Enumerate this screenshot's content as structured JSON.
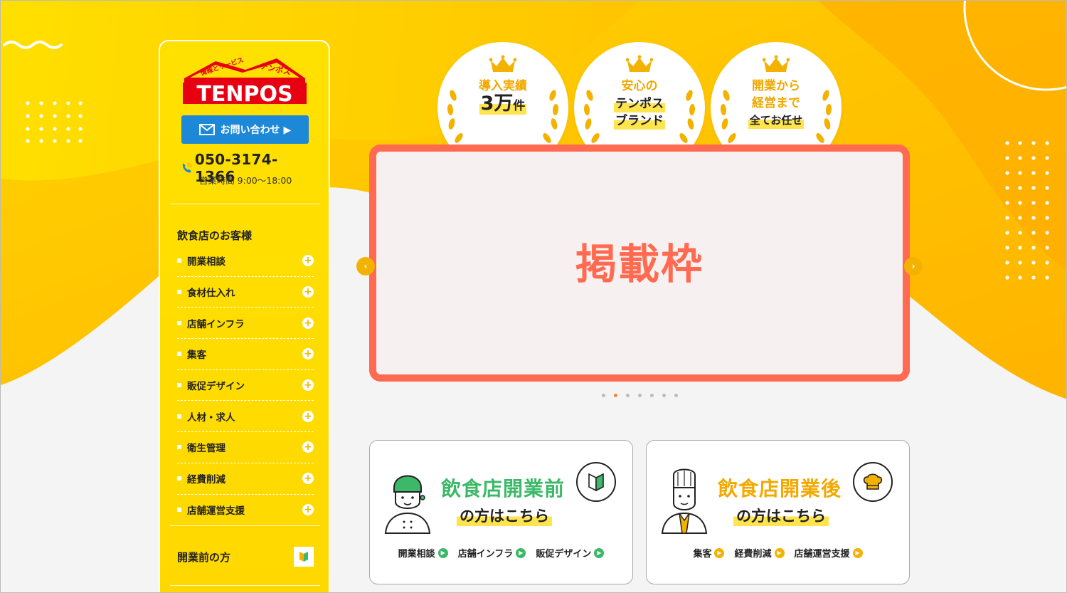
{
  "colors": {
    "brand_yellow": "#ffd800",
    "accent_orange": "#f4b200",
    "contact_blue": "#1e88d8",
    "slider_red": "#ff6a50",
    "green": "#3cb868"
  },
  "logo": {
    "top_left_text": "情報とサービス",
    "top_right_text": "テンポス",
    "main_text": "TENPOS"
  },
  "sidebar": {
    "contact_label": "お問い合わせ ▶",
    "phone": "050-3174-1366",
    "hours": "営業時間 9:00～18:00",
    "section_title": "飲食店のお客様",
    "items": [
      {
        "label": "開業相談"
      },
      {
        "label": "食材仕入れ"
      },
      {
        "label": "店舗インフラ"
      },
      {
        "label": "集客"
      },
      {
        "label": "販促デザイン"
      },
      {
        "label": "人材・求人"
      },
      {
        "label": "衛生管理"
      },
      {
        "label": "経費削減"
      },
      {
        "label": "店舗運営支援"
      }
    ],
    "pre_open_label": "開業前の方"
  },
  "badges": [
    {
      "line1": "導入実績",
      "line2_num": "3万",
      "line2_unit": "件"
    },
    {
      "line1": "安心の",
      "line2": "テンポス",
      "line3": "ブランド"
    },
    {
      "line1": "開業から",
      "line2": "経営まで",
      "line3": "全てお任せ"
    }
  ],
  "slider": {
    "text": "掲載枠",
    "prev_icon": "‹",
    "next_icon": "›",
    "dot_count": 7,
    "active_dot": 1
  },
  "cards": [
    {
      "title": "飲食店開業前",
      "subtitle": "の方はこちら",
      "links": [
        "開業相談",
        "店舗インフラ",
        "販促デザイン"
      ]
    },
    {
      "title": "飲食店開業後",
      "subtitle": "の方はこちら",
      "links": [
        "集客",
        "経費削減",
        "店舗運営支援"
      ]
    }
  ]
}
